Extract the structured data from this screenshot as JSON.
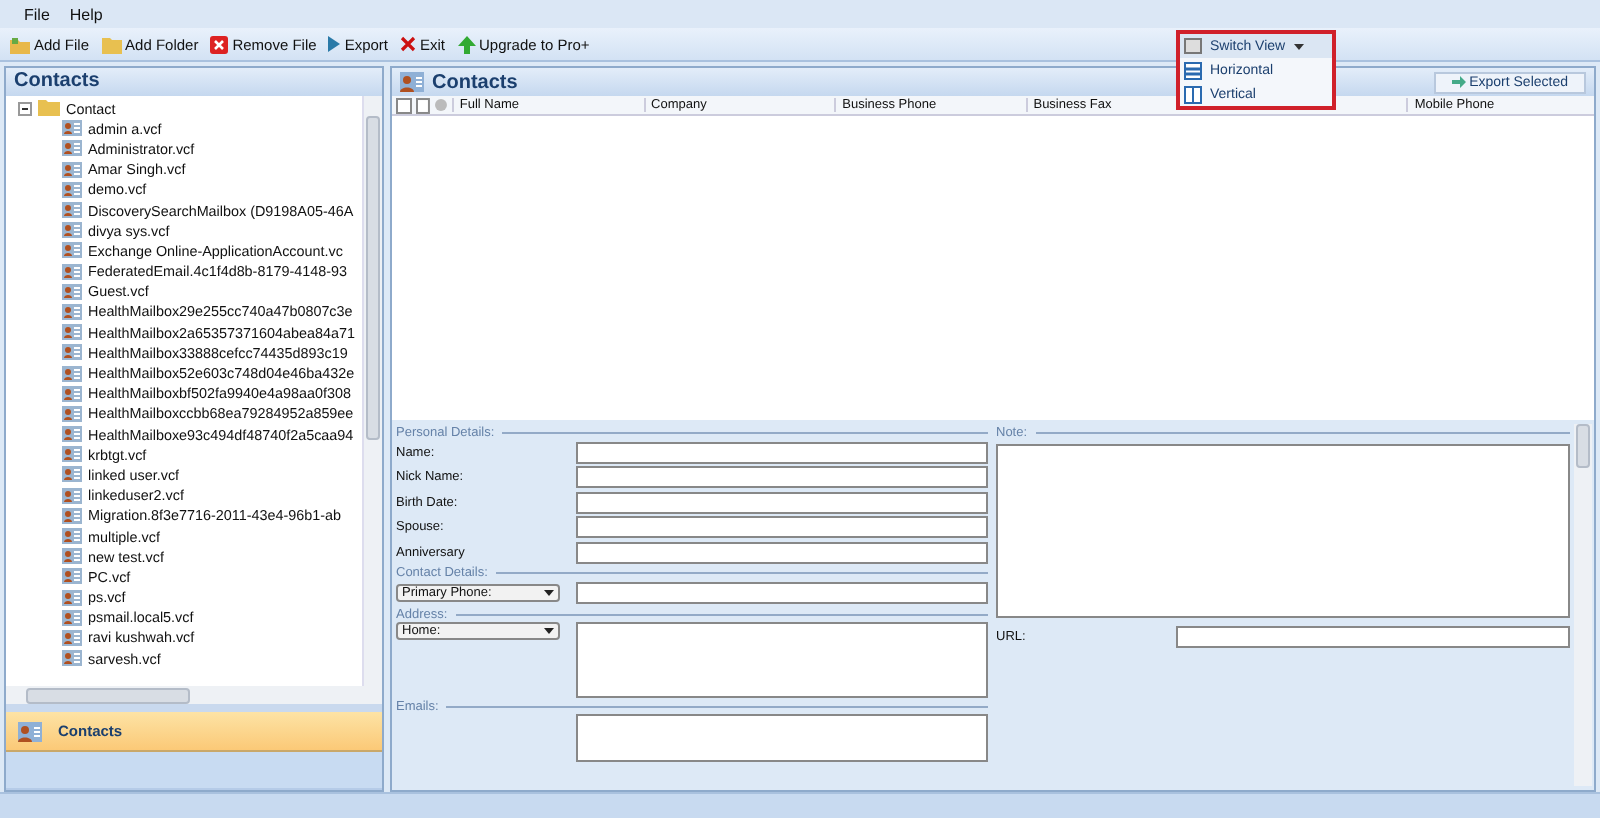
{
  "menu": [
    "File",
    "Help"
  ],
  "toolbar": [
    {
      "kind": "add-file",
      "label": "Add File"
    },
    {
      "kind": "add-folder",
      "label": "Add Folder"
    },
    {
      "kind": "remove",
      "label": "Remove File"
    },
    {
      "kind": "export",
      "label": "Export"
    },
    {
      "kind": "exit",
      "label": "Exit"
    },
    {
      "kind": "upgrade",
      "label": "Upgrade to Pro+"
    }
  ],
  "switch_view": {
    "label": "Switch View",
    "options": [
      {
        "kind": "horizontal",
        "label": "Horizontal"
      },
      {
        "kind": "vertical",
        "label": "Vertical"
      }
    ]
  },
  "left_panel": {
    "title": "Contacts",
    "tree": {
      "label": "Contact",
      "expanded": true,
      "children": [
        {
          "label": "admin a.vcf"
        },
        {
          "label": "Administrator.vcf"
        },
        {
          "label": "Amar Singh.vcf"
        },
        {
          "label": "demo.vcf"
        },
        {
          "label": "DiscoverySearchMailbox (D9198A05-46A"
        },
        {
          "label": "divya sys.vcf"
        },
        {
          "label": "Exchange Online-ApplicationAccount.vc"
        },
        {
          "label": "FederatedEmail.4c1f4d8b-8179-4148-93"
        },
        {
          "label": "Guest.vcf"
        },
        {
          "label": "HealthMailbox29e255cc740a47b0807c3e"
        },
        {
          "label": "HealthMailbox2a65357371604abea84a71"
        },
        {
          "label": "HealthMailbox33888cefcc74435d893c19"
        },
        {
          "label": "HealthMailbox52e603c748d04e46ba432e"
        },
        {
          "label": "HealthMailboxbf502fa9940e4a98aa0f308"
        },
        {
          "label": "HealthMailboxccbb68ea79284952a859ee"
        },
        {
          "label": "HealthMailboxe93c494df48740f2a5caa94"
        },
        {
          "label": "krbtgt.vcf"
        },
        {
          "label": "linked user.vcf"
        },
        {
          "label": "linkeduser2.vcf"
        },
        {
          "label": "Migration.8f3e7716-2011-43e4-96b1-ab"
        },
        {
          "label": "multiple.vcf"
        },
        {
          "label": "new test.vcf"
        },
        {
          "label": "PC.vcf"
        },
        {
          "label": "ps.vcf"
        },
        {
          "label": "psmail.local5.vcf"
        },
        {
          "label": "ravi kushwah.vcf"
        },
        {
          "label": "sarvesh.vcf"
        }
      ]
    },
    "nav": [
      {
        "label": "Contacts",
        "selected": true
      }
    ]
  },
  "contacts_panel": {
    "title": "Contacts",
    "select_all_checked": false,
    "export_button": "Export Selected",
    "columns": [
      "Full Name",
      "Company",
      "Business Phone",
      "Business Fax",
      "Mobile Phone"
    ]
  },
  "details": {
    "personal_legend": "Personal Details:",
    "personal_fields": [
      "Name:",
      "Nick Name:",
      "Birth Date:",
      "Spouse:",
      "Anniversary"
    ],
    "contact_legend": "Contact Details:",
    "phone_select": "Primary Phone:",
    "address_legend": "Address:",
    "address_select": "Home:",
    "emails_legend": "Emails:",
    "note_legend": "Note:",
    "url_label": "URL:"
  }
}
